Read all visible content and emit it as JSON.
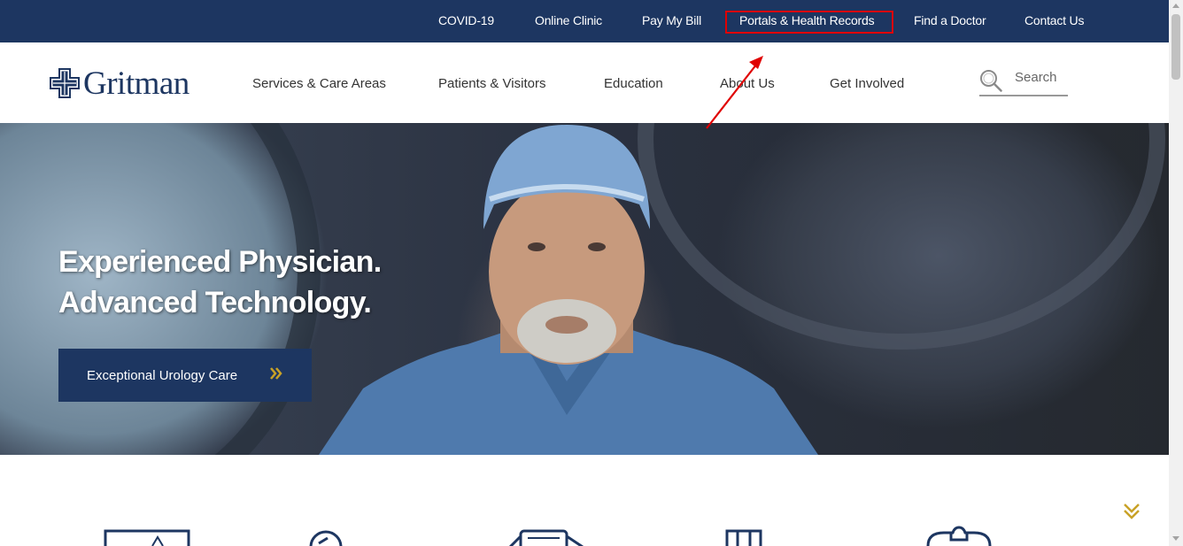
{
  "utility_nav": {
    "items": [
      "COVID-19",
      "Online Clinic",
      "Pay My Bill",
      "Portals & Health Records",
      "Find a Doctor",
      "Contact Us"
    ],
    "highlighted": "Portals & Health Records"
  },
  "logo": {
    "text": "Gritman",
    "icon": "cross-logo-icon"
  },
  "main_nav": {
    "items": [
      "Services & Care Areas",
      "Patients & Visitors",
      "Education",
      "About Us",
      "Get Involved"
    ]
  },
  "search": {
    "placeholder": "Search",
    "icon": "search-icon"
  },
  "hero": {
    "title_line1": "Experienced Physician.",
    "title_line2": "Advanced Technology.",
    "cta_label": "Exceptional Urology Care",
    "cta_icon": "double-chevron-right-icon"
  },
  "colors": {
    "navy": "#1d3661",
    "gold": "#c9a227",
    "annotation_red": "#e00000"
  }
}
